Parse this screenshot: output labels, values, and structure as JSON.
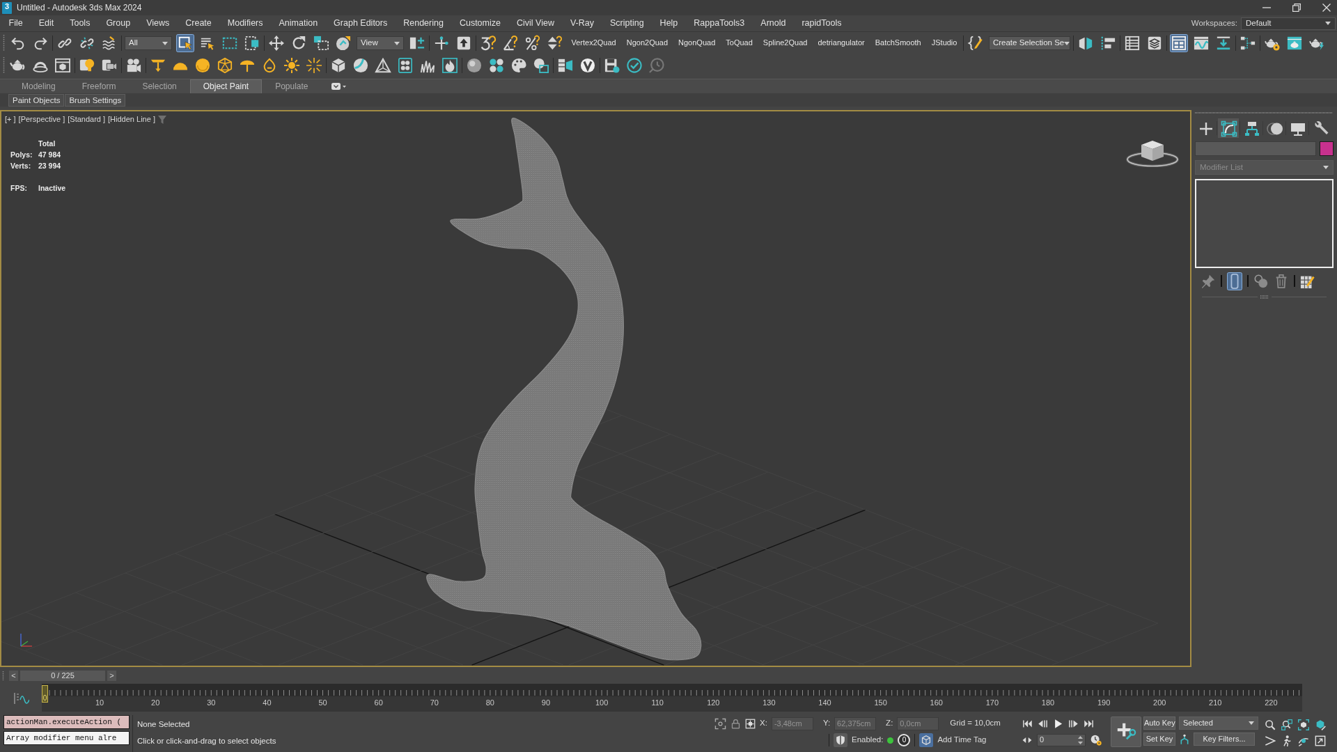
{
  "window": {
    "icon_label": "3",
    "title": "Untitled - Autodesk 3ds Max 2024"
  },
  "menu_bar": {
    "items": [
      "File",
      "Edit",
      "Tools",
      "Group",
      "Views",
      "Create",
      "Modifiers",
      "Animation",
      "Graph Editors",
      "Rendering",
      "Customize",
      "Civil View",
      "V-Ray",
      "Scripting",
      "Help",
      "RappaTools3",
      "Arnold",
      "rapidTools"
    ],
    "workspaces": {
      "label": "Workspaces:",
      "value": "Default"
    }
  },
  "main_toolbar": [
    [
      {
        "kind": "icon",
        "active": false
      },
      {
        "kind": "icon",
        "active": false
      }
    ],
    [
      {
        "kind": "icon",
        "active": false
      },
      {
        "kind": "icon",
        "active": false
      },
      {
        "kind": "icon",
        "active": false
      }
    ],
    [
      {
        "kind": "dropdown",
        "value": "All"
      },
      {
        "kind": "icon",
        "active": true
      },
      {
        "kind": "icon",
        "active": false
      },
      {
        "kind": "icon",
        "active": false
      },
      {
        "kind": "icon",
        "active": false
      }
    ],
    [
      {
        "kind": "icon",
        "active": false
      },
      {
        "kind": "icon",
        "active": false
      },
      {
        "kind": "icon",
        "active": false
      },
      {
        "kind": "icon",
        "active": false
      },
      {
        "kind": "dropdown",
        "value": "View"
      },
      {
        "kind": "icon",
        "active": false
      }
    ],
    [
      {
        "kind": "icon",
        "active": false
      },
      {
        "kind": "icon",
        "active": false
      }
    ],
    [
      {
        "kind": "icon",
        "active": false
      },
      {
        "kind": "icon",
        "active": false
      },
      {
        "kind": "icon",
        "active": false
      },
      {
        "kind": "icon",
        "active": false
      },
      {
        "kind": "text",
        "label": "Vertex2Quad"
      },
      {
        "kind": "text",
        "label": "Ngon2Quad"
      },
      {
        "kind": "text",
        "label": "NgonQuad"
      },
      {
        "kind": "text",
        "label": "ToQuad"
      },
      {
        "kind": "text",
        "label": "Spline2Quad"
      },
      {
        "kind": "text",
        "label": "detriangulator"
      },
      {
        "kind": "text",
        "label": "BatchSmooth"
      },
      {
        "kind": "text",
        "label": "JStudio"
      }
    ],
    [
      {
        "kind": "icon",
        "active": false
      },
      {
        "kind": "dropdown",
        "value": "Create Selection Se"
      }
    ],
    [
      {
        "kind": "icon",
        "active": false
      },
      {
        "kind": "icon",
        "active": false
      }
    ],
    [
      {
        "kind": "icon",
        "active": false
      },
      {
        "kind": "icon",
        "active": false
      }
    ],
    [
      {
        "kind": "icon",
        "active": true
      },
      {
        "kind": "icon",
        "active": false
      },
      {
        "kind": "icon",
        "active": false
      }
    ],
    [
      {
        "kind": "icon",
        "active": false
      }
    ],
    [
      {
        "kind": "icon",
        "active": false
      },
      {
        "kind": "icon",
        "active": false
      },
      {
        "kind": "icon",
        "active": false
      }
    ]
  ],
  "secondary_toolbar": [
    [
      {
        "kind": "icon",
        "active": false
      },
      {
        "kind": "icon",
        "active": false
      },
      {
        "kind": "icon",
        "active": false
      }
    ],
    [
      {
        "kind": "icon",
        "active": false
      },
      {
        "kind": "icon",
        "active": false
      }
    ],
    [
      {
        "kind": "icon",
        "active": false
      }
    ],
    [
      {
        "kind": "icon",
        "active": false
      },
      {
        "kind": "icon",
        "active": false
      },
      {
        "kind": "icon",
        "active": false
      },
      {
        "kind": "icon",
        "active": false
      },
      {
        "kind": "icon",
        "active": false
      },
      {
        "kind": "icon",
        "active": false
      },
      {
        "kind": "icon",
        "active": false
      },
      {
        "kind": "icon",
        "active": false
      }
    ],
    [
      {
        "kind": "icon",
        "active": false
      },
      {
        "kind": "icon",
        "active": false
      },
      {
        "kind": "icon",
        "active": false
      },
      {
        "kind": "icon",
        "active": false
      },
      {
        "kind": "icon",
        "active": false
      },
      {
        "kind": "icon",
        "active": false
      }
    ],
    [
      {
        "kind": "icon",
        "active": false
      },
      {
        "kind": "icon",
        "active": false
      },
      {
        "kind": "icon",
        "active": false
      },
      {
        "kind": "icon",
        "active": false
      }
    ],
    [
      {
        "kind": "icon",
        "active": false
      },
      {
        "kind": "icon",
        "active": false
      }
    ],
    [
      {
        "kind": "icon",
        "active": false
      },
      {
        "kind": "icon",
        "active": false
      },
      {
        "kind": "icon",
        "active": false
      }
    ]
  ],
  "ribbon": {
    "tabs": [
      {
        "label": "Modeling",
        "selected": false
      },
      {
        "label": "Freeform",
        "selected": false
      },
      {
        "label": "Selection",
        "selected": false
      },
      {
        "label": "Object Paint",
        "selected": true
      },
      {
        "label": "Populate",
        "selected": false
      }
    ],
    "panels": [
      "Paint Objects",
      "Brush Settings"
    ]
  },
  "viewport": {
    "active": true,
    "labels": [
      "[+ ]",
      "[Perspective ]",
      "[Standard ]",
      "[Hidden Line ]"
    ],
    "stats": {
      "heading": "Total",
      "rows": [
        {
          "label": "Polys:",
          "value": "47 984"
        },
        {
          "label": "Verts:",
          "value": "23 994"
        }
      ],
      "fps_label": "FPS:",
      "fps_value": "Inactive"
    }
  },
  "command_panel": {
    "tabs": [
      {
        "selected": false
      },
      {
        "selected": true
      },
      {
        "selected": false
      },
      {
        "selected": false
      },
      {
        "selected": false
      },
      {
        "selected": false
      }
    ],
    "object": {
      "color": "#c8318e"
    },
    "modifier_list": {
      "placeholder": "Modifier List"
    },
    "stack_tools": [
      {
        "active": false
      },
      {
        "active": true
      },
      {
        "active": false
      },
      {
        "active": false
      },
      {
        "active": false
      }
    ]
  },
  "time_slider": {
    "previous": "<",
    "value": "0 / 225",
    "next": ">"
  },
  "track_bar": {
    "current_frame": "0",
    "labels": [
      "10",
      "20",
      "30",
      "40",
      "50",
      "60",
      "70",
      "80",
      "90",
      "100",
      "110",
      "120",
      "130",
      "140",
      "150",
      "160",
      "170",
      "180",
      "190",
      "200",
      "210",
      "220"
    ]
  },
  "listener": [
    {
      "kind": "input",
      "text": "actionMan.executeAction ("
    },
    {
      "kind": "output",
      "text": "Array modifier menu alre"
    }
  ],
  "prompt": {
    "selection": "None Selected",
    "hint": "Click or click-and-drag to select objects"
  },
  "coordinates": [
    {
      "axis": "X:",
      "value": "-3,48cm",
      "disabled": true
    },
    {
      "axis": "Y:",
      "value": "62,375cm",
      "disabled": true
    },
    {
      "axis": "Z:",
      "value": "0,0cm",
      "disabled": true
    }
  ],
  "grid_spacing": "Grid = 10,0cm",
  "adaptive_degradation": {
    "label": "Enabled:",
    "enabled": true,
    "count": "0"
  },
  "time_tag": {
    "label": "Add Time Tag"
  },
  "playback": {
    "frame": "0"
  },
  "keys": {
    "auto_key": {
      "label": "Auto Key",
      "on": false
    },
    "set_key": {
      "label": "Set Key"
    },
    "key_set": {
      "value": "Selected"
    },
    "key_filters": {
      "label": "Key Filters..."
    }
  }
}
